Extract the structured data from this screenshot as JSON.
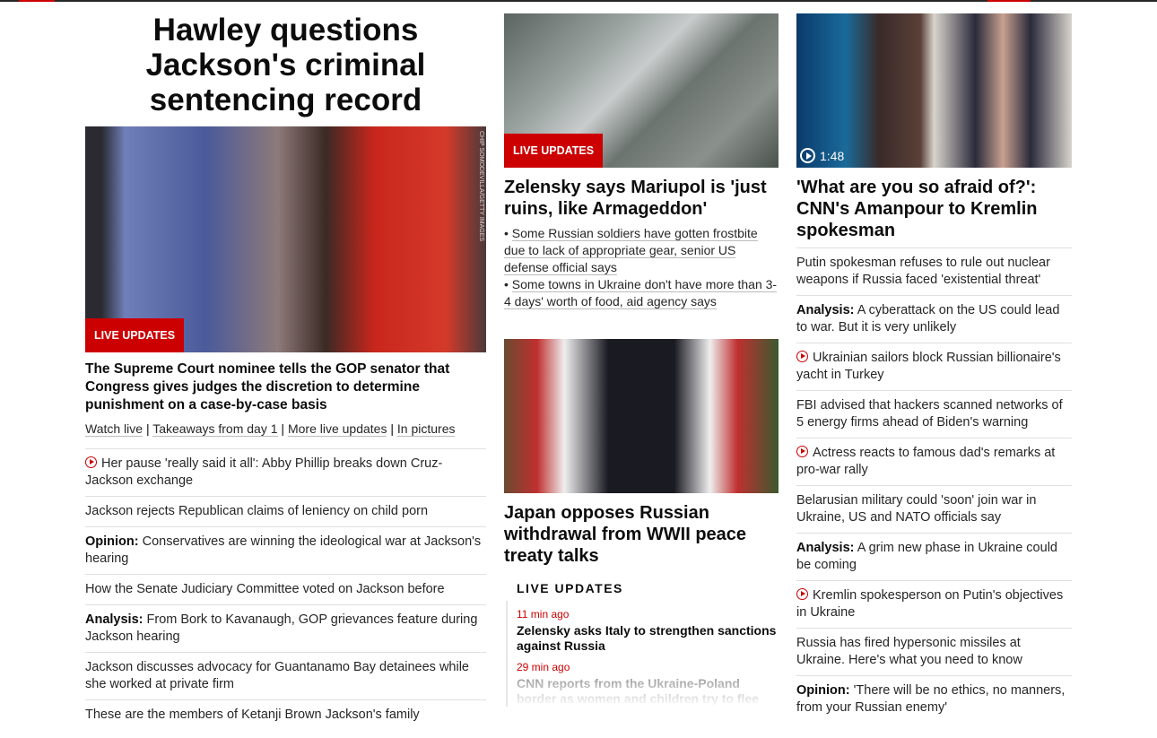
{
  "lead": {
    "headline": "Hawley questions Jackson's criminal sentencing record",
    "badge": "LIVE UPDATES",
    "photo_credit": "CHIP SOMODEVILLA/GETTY IMAGES",
    "caption": "The Supreme Court nominee tells the GOP senator that Congress gives judges the discretion to determine punishment on a case-by-case basis",
    "links": [
      "Watch live",
      "Takeaways from day 1",
      "More live updates",
      "In pictures"
    ],
    "items": [
      {
        "video": true,
        "text": "Her pause 'really said it all': Abby Phillip breaks down Cruz-Jackson exchange"
      },
      {
        "text": "Jackson rejects Republican claims of leniency on child porn"
      },
      {
        "label": "Opinion:",
        "text": "Conservatives are winning the ideological war at Jackson's hearing"
      },
      {
        "text": "How the Senate Judiciary Committee voted on Jackson before"
      },
      {
        "label": "Analysis:",
        "text": "From Bork to Kavanaugh, GOP grievances feature during Jackson hearing"
      },
      {
        "text": "Jackson discusses advocacy for Guantanamo Bay detainees while she worked at private firm"
      },
      {
        "text": "These are the members of Ketanji Brown Jackson's family"
      }
    ]
  },
  "middle": {
    "story1": {
      "badge": "LIVE UPDATES",
      "headline": "Zelensky says Mariupol is 'just ruins, like Armageddon'",
      "bullets": [
        "Some Russian soldiers have gotten frostbite due to lack of appropriate gear, senior US defense official says",
        "Some towns in Ukraine don't have more than 3-4 days' worth of food, aid agency says"
      ]
    },
    "story2": {
      "headline": "Japan opposes Russian withdrawal from WWII peace treaty talks"
    },
    "live": {
      "title": "LIVE UPDATES",
      "entries": [
        {
          "time": "11 min ago",
          "text": "Zelensky asks Italy to strengthen sanctions against Russia"
        },
        {
          "time": "29 min ago",
          "text": "CNN reports from the Ukraine-Poland border as women and children try to flee"
        }
      ]
    }
  },
  "right": {
    "duration": "1:48",
    "headline": "'What are you so afraid of?': CNN's Amanpour to Kremlin spokesman",
    "items": [
      {
        "text": "Putin spokesman refuses to rule out nuclear weapons if Russia faced 'existential threat'"
      },
      {
        "label": "Analysis:",
        "text": "A cyberattack on the US could lead to war. But it is very unlikely"
      },
      {
        "video": true,
        "text": "Ukrainian sailors block Russian billionaire's yacht in Turkey"
      },
      {
        "text": "FBI advised that hackers scanned networks of 5 energy firms ahead of Biden's warning"
      },
      {
        "video": true,
        "text": "Actress reacts to famous dad's remarks at pro-war rally"
      },
      {
        "text": "Belarusian military could 'soon' join war in Ukraine, US and NATO officials say"
      },
      {
        "label": "Analysis:",
        "text": "A grim new phase in Ukraine could be coming"
      },
      {
        "video": true,
        "text": "Kremlin spokesperson on Putin's objectives in Ukraine"
      },
      {
        "text": "Russia has fired hypersonic missiles at Ukraine. Here's what you need to know"
      },
      {
        "label": "Opinion:",
        "text": "'There will be no ethics, no manners, from your Russian enemy'"
      }
    ]
  },
  "colors": {
    "accent": "#cc0000"
  }
}
